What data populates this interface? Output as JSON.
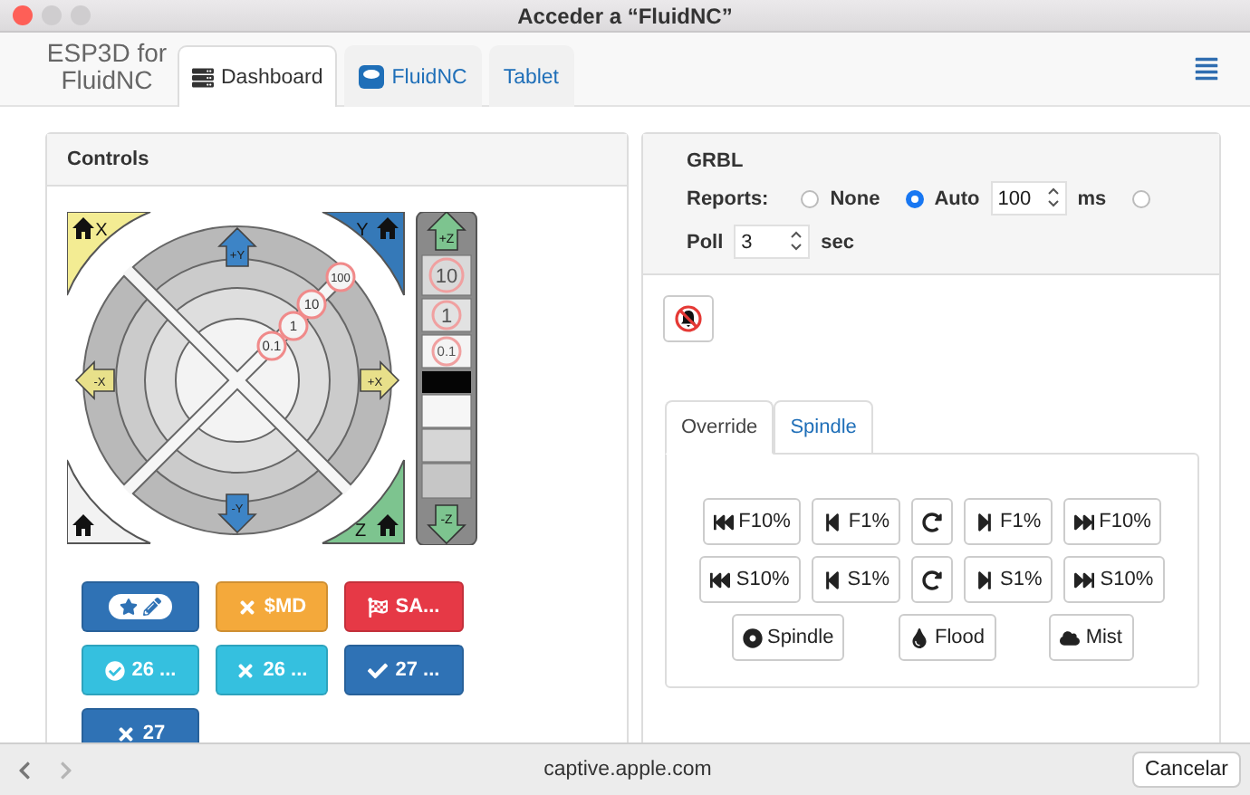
{
  "window": {
    "title": "Acceder a “FluidNC”"
  },
  "header": {
    "brand": "ESP3D for FluidNC",
    "tabs": [
      {
        "label": "Dashboard",
        "selected": true
      },
      {
        "label": "FluidNC",
        "selected": false
      },
      {
        "label": "Tablet",
        "selected": false
      }
    ]
  },
  "controls": {
    "title": "Controls",
    "jog": {
      "home": [
        "X",
        "Y",
        "Z"
      ],
      "arrows": [
        "+Y",
        "-Y",
        "-X",
        "+X"
      ],
      "z_up": "+Z",
      "z_down": "-Z",
      "z_steps": [
        "10",
        "1",
        "0.1"
      ],
      "xy_steps": [
        "100",
        "10",
        "1",
        "0.1"
      ]
    },
    "macros": [
      {
        "color": "#2f72b5"
      },
      {
        "label": "$MD",
        "color": "#f4a93b"
      },
      {
        "label": "SA...",
        "color": "#e63946"
      },
      {
        "label": "26 ...",
        "color": "#35c0df"
      },
      {
        "label": "26 ...",
        "color": "#35c0df"
      },
      {
        "label": "27 ...",
        "color": "#2f72b5"
      },
      {
        "label": "27",
        "color": "#2f72b5"
      }
    ]
  },
  "grbl": {
    "title": "GRBL",
    "reports_label": "Reports:",
    "options": [
      {
        "label": "None",
        "selected": false
      },
      {
        "label": "Auto",
        "selected": true
      },
      {
        "selected": false
      }
    ],
    "interval": "100",
    "interval_unit": "ms",
    "poll_label": "Poll",
    "poll": "3",
    "poll_unit": "sec"
  },
  "override_tabs": [
    {
      "label": "Override",
      "selected": true
    },
    {
      "label": "Spindle",
      "selected": false
    }
  ],
  "override_rows": [
    [
      "F10%",
      "F1%",
      null,
      "F1%",
      "F10%"
    ],
    [
      "S10%",
      "S1%",
      null,
      "S1%",
      "S10%"
    ]
  ],
  "coolant": [
    "Spindle",
    "Flood",
    "Mist"
  ],
  "browser_bar": {
    "url": "captive.apple.com",
    "cancel": "Cancelar"
  }
}
